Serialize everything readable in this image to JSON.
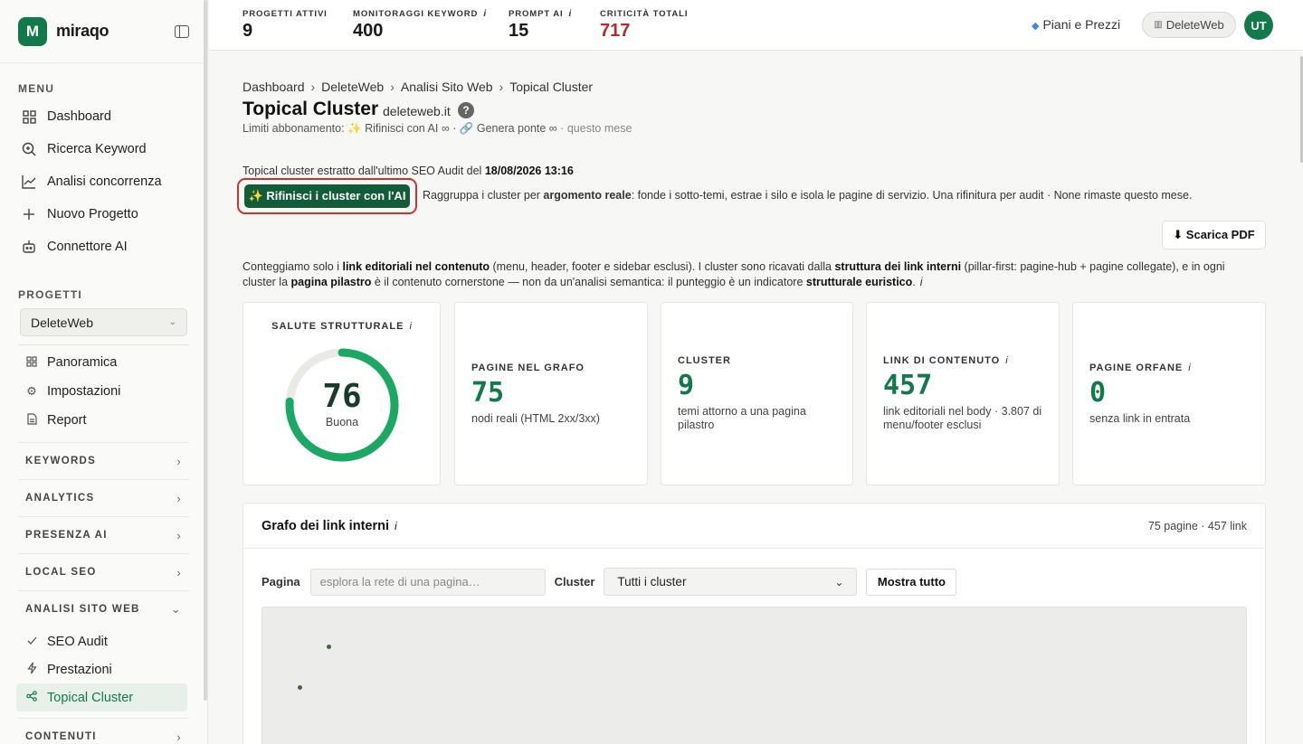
{
  "brand": {
    "name": "miraqo",
    "logo_letter": "M"
  },
  "sidebar": {
    "menu_label": "MENU",
    "menu": [
      {
        "label": "Dashboard",
        "icon": "grid-icon"
      },
      {
        "label": "Ricerca Keyword",
        "icon": "search-icon"
      },
      {
        "label": "Analisi concorrenza",
        "icon": "chart-line-icon"
      },
      {
        "label": "Nuovo Progetto",
        "icon": "plus-icon"
      },
      {
        "label": "Connettore AI",
        "icon": "robot-icon"
      }
    ],
    "projects_label": "PROGETTI",
    "project_selected": "DeleteWeb",
    "project_items": [
      {
        "label": "Panoramica",
        "icon": "grid-icon"
      },
      {
        "label": "Impostazioni",
        "icon": "gear-icon"
      },
      {
        "label": "Report",
        "icon": "document-icon"
      }
    ],
    "groups": [
      "KEYWORDS",
      "ANALYTICS",
      "PRESENZA AI",
      "LOCAL SEO",
      "ANALISI SITO WEB",
      "CONTENUTI"
    ],
    "site_items": [
      {
        "label": "SEO Audit",
        "icon": "audit-icon"
      },
      {
        "label": "Prestazioni",
        "icon": "lightning-icon"
      },
      {
        "label": "Topical Cluster",
        "icon": "share-nodes-icon"
      }
    ]
  },
  "topbar": {
    "stats": [
      {
        "label": "PROGETTI ATTIVI",
        "value": "9"
      },
      {
        "label": "MONITORAGGI KEYWORD",
        "value": "400",
        "info": "i"
      },
      {
        "label": "PROMPT AI",
        "value": "15",
        "info": "i"
      },
      {
        "label": "CRITICITÀ TOTALI",
        "value": "717",
        "color": "#b32b2b"
      }
    ],
    "pricing": "Piani e Prezzi",
    "workspace": "DeleteWeb",
    "avatar": "UT"
  },
  "page": {
    "breadcrumb": [
      "Dashboard",
      "DeleteWeb",
      "Analisi Sito Web",
      "Topical Cluster"
    ],
    "breadcrumb_sep": "›",
    "title": "Topical Cluster",
    "domain": "deleteweb.it",
    "help": "?",
    "limits_text": "Limiti abbonamento: ✨ Rifinisci con AI ∞ · 🔗 Genera ponte ∞",
    "limits_suffix": "· questo mese",
    "extracted_prefix": "Topical cluster estratto dall'ultimo SEO Audit del",
    "extracted_date": "18/08/2026 13:16",
    "refine_button": "✨ Rifinisci i cluster con l'AI",
    "refine_desc_a": "Raggruppa i cluster per",
    "refine_desc_b": "argomento reale",
    "refine_desc_c": ": fonde i sotto-temi, estrae i silo e isola le pagine di servizio. Una rifinitura per audit · None rimaste questo mese.",
    "pdf_button": "⬇ Scarica PDF",
    "note": {
      "p1": "Conteggiamo solo i ",
      "b1": "link editoriali nel contenuto",
      "p2": " (menu, header, footer e sidebar esclusi). I cluster sono ricavati dalla ",
      "b2": "struttura dei link interni",
      "p3": " (pillar-first: pagine-hub + pagine collegate), e in ogni cluster la ",
      "b3": "pagina pilastro",
      "p4": " è il contenuto cornerstone — non da un'analisi semantica: il punteggio è un indicatore ",
      "b4": "strutturale euristico",
      "p5": "."
    },
    "accent": "#127a4a"
  },
  "cards": {
    "health": {
      "label": "SALUTE STRUTTURALE",
      "value": "76",
      "max": 100,
      "sub": "Buona"
    },
    "pages": {
      "label": "PAGINE NEL GRAFO",
      "value": "75",
      "sub": "nodi reali (HTML 2xx/3xx)"
    },
    "clusters": {
      "label": "CLUSTER",
      "value": "9",
      "sub": "temi attorno a una pagina pilastro"
    },
    "links": {
      "label": "LINK DI CONTENUTO",
      "value": "457",
      "sub": "link editoriali nel body · 3.807 di menu/footer esclusi"
    },
    "orphans": {
      "label": "PAGINE ORFANE",
      "value": "0",
      "sub": "senza link in entrata"
    }
  },
  "graph": {
    "title": "Grafo dei link interni",
    "meta": "75 pagine · 457 link",
    "page_label": "Pagina",
    "page_placeholder": "esplora la rete di una pagina…",
    "cluster_label": "Cluster",
    "cluster_selected": "Tutti i cluster",
    "show_all": "Mostra tutto"
  }
}
